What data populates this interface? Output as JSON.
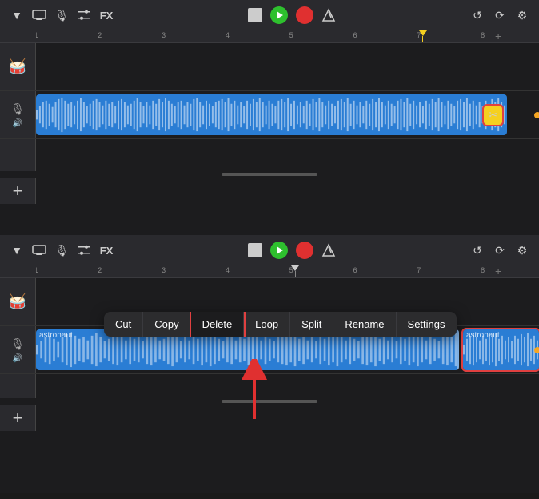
{
  "panels": {
    "top": {
      "toolbar": {
        "items": [
          "dropdown-icon",
          "screen-icon",
          "mic-icon",
          "sliders-icon",
          "fx-label",
          "stop-btn",
          "play-btn",
          "record-btn",
          "metronome-icon",
          "undo-icon",
          "loop-icon",
          "settings-icon"
        ]
      },
      "fx_label": "FX",
      "tracks": [
        {
          "id": "drums-top",
          "type": "drums",
          "icon": "🥁"
        },
        {
          "id": "audio-top",
          "type": "audio",
          "clip_label": "",
          "has_cut_cursor": true
        }
      ]
    },
    "bottom": {
      "toolbar": {
        "fx_label": "FX"
      },
      "tracks": [
        {
          "id": "drums-bottom",
          "type": "drums",
          "icon": "🥁"
        },
        {
          "id": "audio-bottom",
          "type": "audio",
          "clip_label": "astronaut",
          "has_copy_clip": true,
          "copy_clip_label": "astronaut"
        }
      ],
      "context_menu": {
        "items": [
          "Cut",
          "Copy",
          "Delete",
          "Loop",
          "Split",
          "Rename",
          "Settings"
        ],
        "active_item": "Delete"
      }
    }
  },
  "arrow": {
    "pointing_to": "Delete"
  }
}
